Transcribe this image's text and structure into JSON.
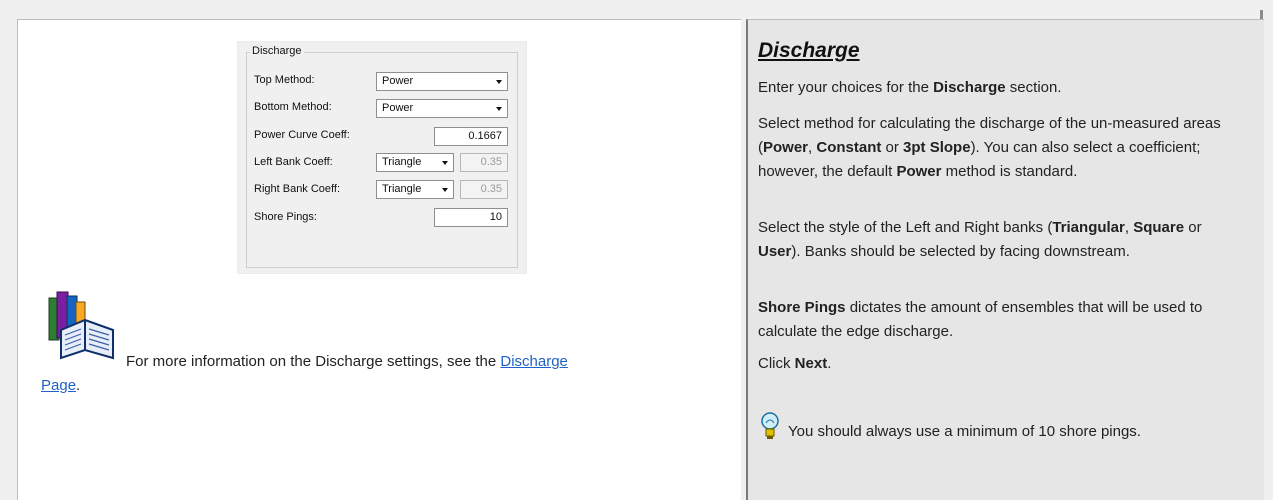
{
  "settings": {
    "group_title": "Discharge",
    "top_method": {
      "label": "Top Method:",
      "value": "Power"
    },
    "bottom_method": {
      "label": "Bottom Method:",
      "value": "Power"
    },
    "power_curve": {
      "label": "Power Curve Coeff:",
      "value": "0.1667"
    },
    "left_bank": {
      "label": "Left Bank Coeff:",
      "value": "Triangle",
      "coeff": "0.35"
    },
    "right_bank": {
      "label": "Right Bank Coeff:",
      "value": "Triangle",
      "coeff": "0.35"
    },
    "shore_pings": {
      "label": "Shore Pings:",
      "value": "10"
    }
  },
  "info": {
    "text": "For more information on the Discharge settings, see the ",
    "link_part1": "Discharge",
    "link_part2": "Page",
    "end": ".",
    "icon": "book-stack-icon"
  },
  "help": {
    "title": "Discharge",
    "p1_a": "Enter your choices for the ",
    "p1_b": "Discharge",
    "p1_c": " section.",
    "p2_a": "Select method for calculating the discharge of the un-measured areas (",
    "p2_power": "Power",
    "p2_sep1": ", ",
    "p2_constant": "Constant",
    "p2_or": " or ",
    "p2_slope": "3pt Slope",
    "p2_b": "). You can also select a coefficient; however, the default ",
    "p2_power2": "Power",
    "p2_c": " method is standard.",
    "p3_a": "Select the style of the Left and Right banks (",
    "p3_tri": "Triangular",
    "p3_sep": ", ",
    "p3_sq": "Square",
    "p3_or": " or ",
    "p3_user": "User",
    "p3_b": "). Banks should be selected by facing downstream.",
    "p4_bold": "Shore Pings",
    "p4_rest": " dictates the amount of ensembles that will be used to calculate the edge discharge.",
    "p5_a": "Click ",
    "p5_b": "Next",
    "p5_c": ".",
    "tip": "You should always use a minimum of 10 shore pings.",
    "tip_icon": "lightbulb-icon"
  }
}
